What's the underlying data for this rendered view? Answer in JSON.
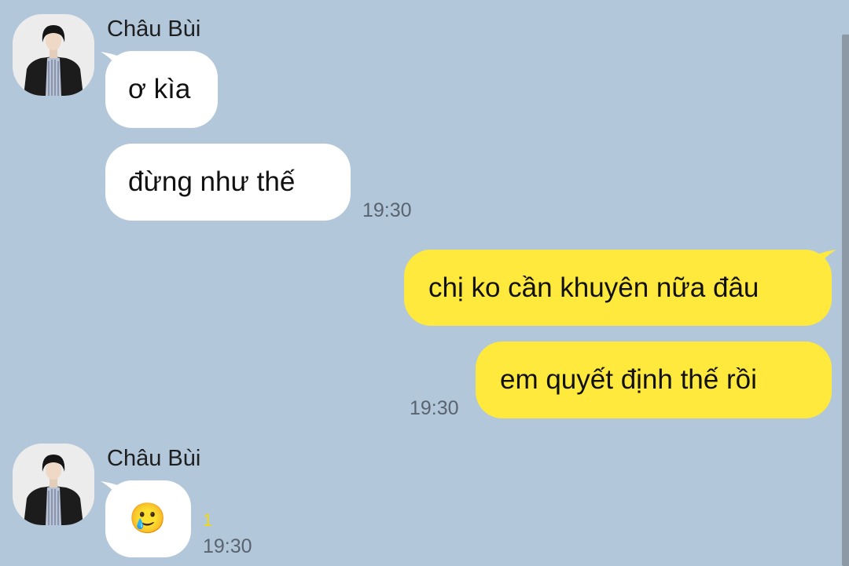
{
  "colors": {
    "background": "#b2c7da",
    "incoming_bubble": "#ffffff",
    "outgoing_bubble": "#fee93c",
    "unread_count": "#f5d90a"
  },
  "messages": {
    "group1": {
      "sender": "Châu Bùi",
      "bubble1": "ơ kìa",
      "bubble2": "đừng như thế",
      "time": "19:30"
    },
    "group2": {
      "bubble1": "chị ko cần khuyên nữa đâu",
      "bubble2": "em quyết định thế rồi",
      "time": "19:30"
    },
    "group3": {
      "sender": "Châu Bùi",
      "emoji": "🥲",
      "unread": "1",
      "time": "19:30"
    }
  }
}
